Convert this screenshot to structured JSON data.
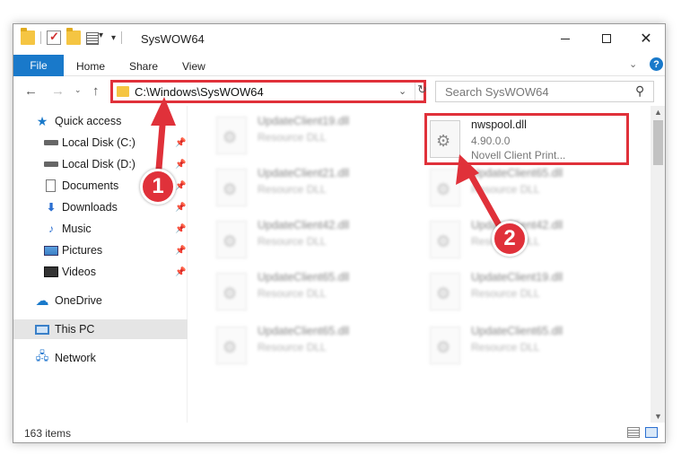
{
  "window": {
    "title": "SysWOW64",
    "minimize_label": "Minimize",
    "maximize_label": "Maximize",
    "close_glyph": "✕"
  },
  "ribbon": {
    "tabs": [
      {
        "label": "File"
      },
      {
        "label": "Home"
      },
      {
        "label": "Share"
      },
      {
        "label": "View"
      }
    ],
    "help_glyph": "?"
  },
  "navigation": {
    "address": "C:\\Windows\\SysWOW64",
    "search_placeholder": "Search SysWOW64"
  },
  "sidebar": {
    "items": [
      {
        "label": "Quick access",
        "icon": "star-icon"
      },
      {
        "label": "Local Disk (C:)",
        "icon": "disk-icon",
        "pinned": true
      },
      {
        "label": "Local Disk (D:)",
        "icon": "disk-icon",
        "pinned": true
      },
      {
        "label": "Documents",
        "icon": "documents-icon",
        "pinned": true
      },
      {
        "label": "Downloads",
        "icon": "download-icon",
        "pinned": true
      },
      {
        "label": "Music",
        "icon": "music-icon",
        "pinned": true
      },
      {
        "label": "Pictures",
        "icon": "pictures-icon",
        "pinned": true
      },
      {
        "label": "Videos",
        "icon": "videos-icon",
        "pinned": true
      },
      {
        "label": "OneDrive",
        "icon": "cloud-icon"
      },
      {
        "label": "This PC",
        "icon": "computer-icon",
        "selected": true
      },
      {
        "label": "Network",
        "icon": "network-icon"
      }
    ]
  },
  "files": {
    "highlighted": {
      "name": "nwspool.dll",
      "version": "4.90.0.0",
      "description": "Novell Client Print..."
    },
    "left_column": [
      {
        "name": "UpdateClient19.dll",
        "type": "Resource DLL"
      },
      {
        "name": "UpdateClient21.dll",
        "type": "Resource DLL"
      },
      {
        "name": "UpdateClient42.dll",
        "type": "Resource DLL"
      },
      {
        "name": "UpdateClient65.dll",
        "type": "Resource DLL"
      },
      {
        "name": "UpdateClient65.dll",
        "type": "Resource DLL"
      }
    ],
    "right_column": [
      {
        "name": "UpdateClient65.dll",
        "type": "Resource DLL"
      },
      {
        "name": "UpdateClient42.dll",
        "type": "Resource DLL"
      },
      {
        "name": "UpdateClient19.dll",
        "type": "Resource DLL"
      },
      {
        "name": "UpdateClient65.dll",
        "type": "Resource DLL"
      }
    ]
  },
  "status": {
    "item_count": "163 items"
  },
  "callouts": {
    "step1": "1",
    "step2": "2"
  },
  "colors": {
    "accent": "#1979ca",
    "highlight_red": "#e0313a"
  }
}
